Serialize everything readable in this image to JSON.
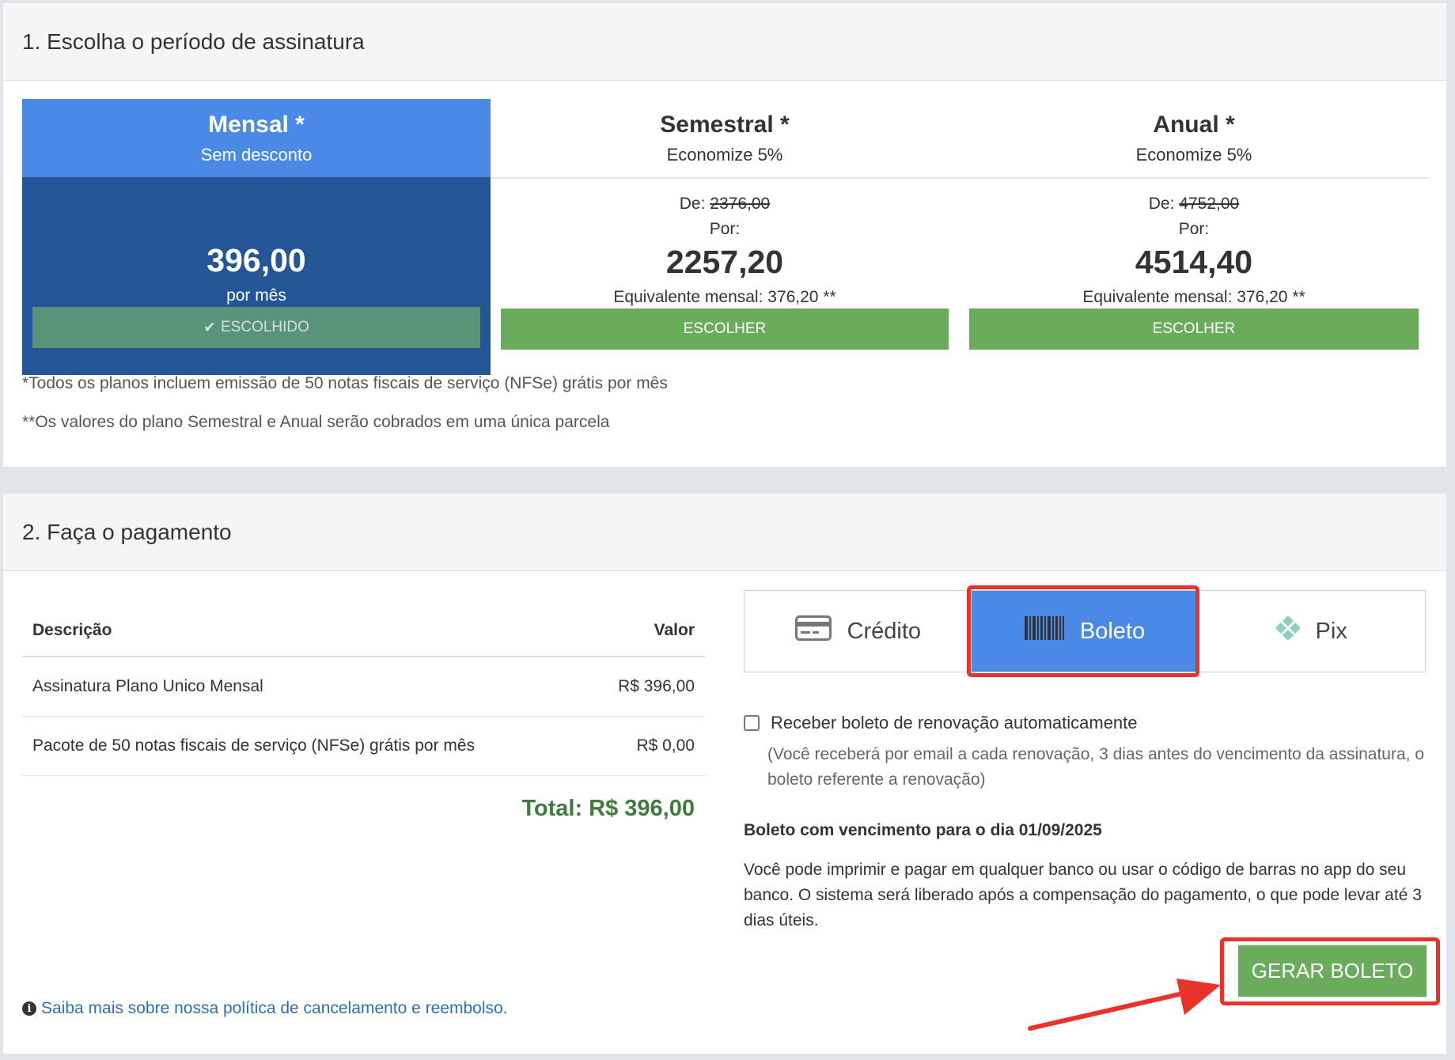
{
  "section1": {
    "title": "1. Escolha o período de assinatura",
    "plans": [
      {
        "name": "Mensal *",
        "subtitle": "Sem desconto",
        "price": "396,00",
        "price_note": "por mês",
        "button_label": "ESCOLHIDO",
        "selected": true
      },
      {
        "name": "Semestral *",
        "subtitle": "Economize 5%",
        "de_label": "De:",
        "de_value": "2376,00",
        "por_label": "Por:",
        "price": "2257,20",
        "equivalent": "Equivalente mensal: 376,20 **",
        "button_label": "ESCOLHER",
        "selected": false
      },
      {
        "name": "Anual *",
        "subtitle": "Economize 5%",
        "de_label": "De:",
        "de_value": "4752,00",
        "por_label": "Por:",
        "price": "4514,40",
        "equivalent": "Equivalente mensal: 376,20 **",
        "button_label": "ESCOLHER",
        "selected": false
      }
    ],
    "footnote1": "*Todos os planos incluem emissão de 50 notas fiscais de serviço (NFSe) grátis por mês",
    "footnote2": "**Os valores do plano Semestral e Anual serão cobrados em uma única parcela"
  },
  "section2": {
    "title": "2. Faça o pagamento",
    "table": {
      "headers": [
        "Descrição",
        "Valor"
      ],
      "rows": [
        [
          "Assinatura Plano Unico Mensal",
          "R$ 396,00"
        ],
        [
          "Pacote de 50 notas fiscais de serviço (NFSe) grátis por mês",
          "R$ 0,00"
        ]
      ],
      "total": "Total: R$ 396,00"
    },
    "payment_tabs": [
      {
        "label": "Crédito",
        "icon": "credit-card-icon",
        "active": false
      },
      {
        "label": "Boleto",
        "icon": "barcode-icon",
        "active": true
      },
      {
        "label": "Pix",
        "icon": "pix-icon",
        "active": false
      }
    ],
    "renew_label": "Receber boleto de renovação automaticamente",
    "renew_note": "(Você receberá por email a cada renovação, 3 dias antes do vencimento da assinatura, o boleto referente a renovação)",
    "due_date": "Boleto com vencimento para o dia 01/09/2025",
    "info_text": "Você pode imprimir e pagar em qualquer banco ou usar o código de barras no app do seu banco. O sistema será liberado após a compensação do pagamento, o que pode levar até 3 dias úteis.",
    "generate_button": "GERAR BOLETO",
    "cancel_link": "Saiba mais sobre nossa política de cancelamento e reembolso."
  },
  "colors": {
    "selected_plan_head": "#4a8ae6",
    "selected_plan_body": "#245597",
    "green_button": "#6aac5c",
    "highlight_red": "#e8332a",
    "total_green": "#3f7a3f",
    "link_blue": "#2f6fb0"
  }
}
